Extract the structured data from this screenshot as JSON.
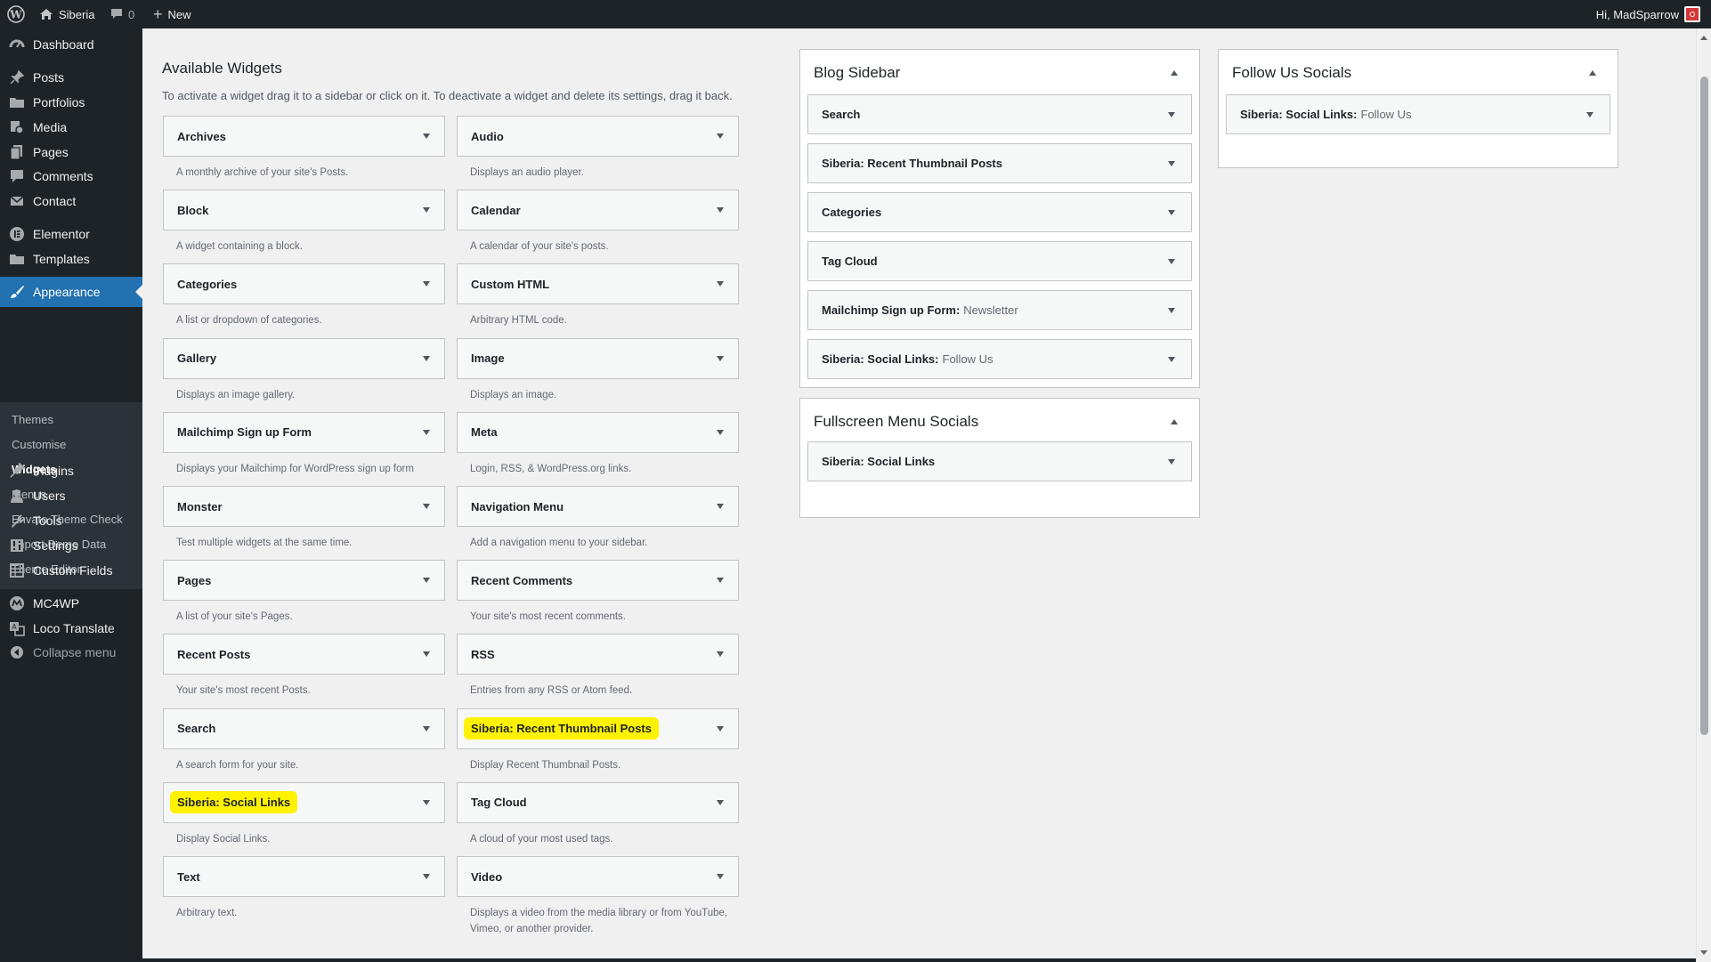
{
  "admin_bar": {
    "site_name": "Siberia",
    "comments_count": "0",
    "new_label": "New",
    "greeting": "Hi, MadSparrow"
  },
  "sidebar": {
    "items": [
      {
        "label": "Dashboard",
        "icon": "dashboard-icon"
      },
      {
        "label": "Posts",
        "icon": "pin-icon"
      },
      {
        "label": "Portfolios",
        "icon": "folder-icon"
      },
      {
        "label": "Media",
        "icon": "media-icon"
      },
      {
        "label": "Pages",
        "icon": "pages-icon"
      },
      {
        "label": "Comments",
        "icon": "comment-icon"
      },
      {
        "label": "Contact",
        "icon": "mail-icon"
      },
      {
        "label": "Elementor",
        "icon": "elementor-icon"
      },
      {
        "label": "Templates",
        "icon": "folder-icon"
      },
      {
        "label": "Appearance",
        "icon": "brush-icon"
      },
      {
        "label": "Plugins",
        "icon": "plugin-icon"
      },
      {
        "label": "Users",
        "icon": "user-icon"
      },
      {
        "label": "Tools",
        "icon": "wrench-icon"
      },
      {
        "label": "Settings",
        "icon": "settings-icon"
      },
      {
        "label": "Custom Fields",
        "icon": "grid-icon"
      },
      {
        "label": "MC4WP",
        "icon": "mc4wp-icon"
      },
      {
        "label": "Loco Translate",
        "icon": "translate-icon"
      }
    ],
    "submenu": [
      "Themes",
      "Customise",
      "Widgets",
      "Menus",
      "Envato Theme Check",
      "Import Demo Data",
      "Theme Editor"
    ],
    "collapse_label": "Collapse menu"
  },
  "available": {
    "title": "Available Widgets",
    "description": "To activate a widget drag it to a sidebar or click on it. To deactivate a widget and delete its settings, drag it back.",
    "widgets": [
      {
        "name": "Archives",
        "desc": "A monthly archive of your site's Posts."
      },
      {
        "name": "Audio",
        "desc": "Displays an audio player."
      },
      {
        "name": "Block",
        "desc": "A widget containing a block."
      },
      {
        "name": "Calendar",
        "desc": "A calendar of your site's posts."
      },
      {
        "name": "Categories",
        "desc": "A list or dropdown of categories."
      },
      {
        "name": "Custom HTML",
        "desc": "Arbitrary HTML code."
      },
      {
        "name": "Gallery",
        "desc": "Displays an image gallery."
      },
      {
        "name": "Image",
        "desc": "Displays an image."
      },
      {
        "name": "Mailchimp Sign up Form",
        "desc": "Displays your Mailchimp for WordPress sign up form"
      },
      {
        "name": "Meta",
        "desc": "Login, RSS, & WordPress.org links."
      },
      {
        "name": "Monster",
        "desc": "Test multiple widgets at the same time."
      },
      {
        "name": "Navigation Menu",
        "desc": "Add a navigation menu to your sidebar."
      },
      {
        "name": "Pages",
        "desc": "A list of your site's Pages."
      },
      {
        "name": "Recent Comments",
        "desc": "Your site's most recent comments."
      },
      {
        "name": "Recent Posts",
        "desc": "Your site's most recent Posts."
      },
      {
        "name": "RSS",
        "desc": "Entries from any RSS or Atom feed."
      },
      {
        "name": "Search",
        "desc": "A search form for your site."
      },
      {
        "name": "Siberia: Recent Thumbnail Posts",
        "desc": "Display Recent Thumbnail Posts."
      },
      {
        "name": "Siberia: Social Links",
        "desc": "Display Social Links."
      },
      {
        "name": "Tag Cloud",
        "desc": "A cloud of your most used tags."
      },
      {
        "name": "Text",
        "desc": "Arbitrary text."
      },
      {
        "name": "Video",
        "desc": "Displays a video from the media library or from YouTube, Vimeo, or another provider."
      }
    ]
  },
  "areas": [
    {
      "title": "Blog Sidebar",
      "widgets": [
        {
          "title": "Search",
          "subtitle": ""
        },
        {
          "title": "Siberia: Recent Thumbnail Posts",
          "subtitle": ""
        },
        {
          "title": "Categories",
          "subtitle": ""
        },
        {
          "title": "Tag Cloud",
          "subtitle": ""
        },
        {
          "title": "Mailchimp Sign up Form:",
          "subtitle": "Newsletter"
        },
        {
          "title": "Siberia: Social Links:",
          "subtitle": "Follow Us"
        }
      ]
    },
    {
      "title": "Fullscreen Menu Socials",
      "widgets": [
        {
          "title": "Siberia: Social Links",
          "subtitle": ""
        }
      ]
    },
    {
      "title": "Follow Us Socials",
      "widgets": [
        {
          "title": "Siberia: Social Links:",
          "subtitle": "Follow Us"
        }
      ]
    }
  ],
  "colors": {
    "admin_bg": "#1d2327",
    "accent": "#2271b1",
    "highlight": "#fff200"
  }
}
